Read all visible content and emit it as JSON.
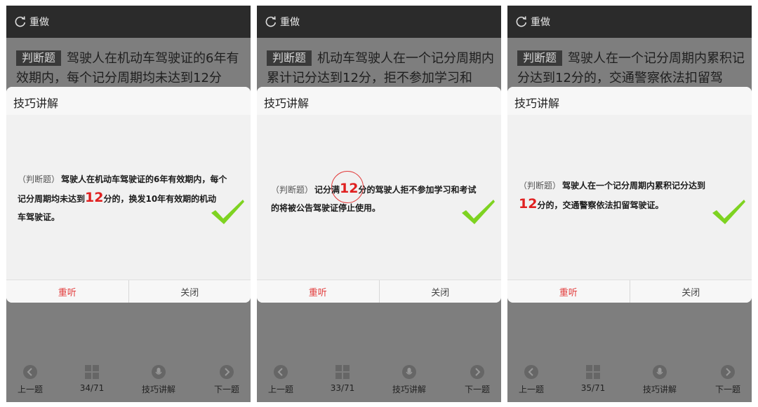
{
  "screens": [
    {
      "redo_label": "重做",
      "question_tag": "判断题",
      "question_text": "驾驶人在机动车驾驶证的6年有效期内，每个记分周期均未达到12分",
      "dialog_title": "技巧讲解",
      "explanation": {
        "prefix": "（判断题）",
        "line1": "驾驶人在机动车驾驶证的6年有效期内，每个",
        "line2_before": "记分周期均未达到",
        "highlight": "12",
        "line2_after": "分的，换发10年有效期的机动",
        "line3": "车驾驶证。"
      },
      "replay_label": "重听",
      "close_label": "关闭",
      "nav": {
        "prev": "上一题",
        "progress": "34/71",
        "tips": "技巧讲解",
        "next": "下一题"
      }
    },
    {
      "redo_label": "重做",
      "question_tag": "判断题",
      "question_text": "机动车驾驶人在一个记分周期内累计记分达到12分，拒不参加学习和",
      "dialog_title": "技巧讲解",
      "explanation": {
        "prefix": "（判断题）",
        "line1_before": "记分满",
        "highlight": "12",
        "line1_after": "分的驾驶人拒不参加学习和考试",
        "line2": "的将被公告驾驶证停止使用。"
      },
      "replay_label": "重听",
      "close_label": "关闭",
      "nav": {
        "prev": "上一题",
        "progress": "33/71",
        "tips": "技巧讲解",
        "next": "下一题"
      }
    },
    {
      "redo_label": "重做",
      "question_tag": "判断题",
      "question_text": "驾驶人在一个记分周期内累积记分达到12分的，交通警察依法扣留驾",
      "dialog_title": "技巧讲解",
      "explanation": {
        "prefix": "（判断题）",
        "line1": "驾驶人在一个记分周期内累积记分达到",
        "highlight": "12",
        "line2_after": "分的，交通警察依法扣留驾驶证。"
      },
      "replay_label": "重听",
      "close_label": "关闭",
      "nav": {
        "prev": "上一题",
        "progress": "35/71",
        "tips": "技巧讲解",
        "next": "下一题"
      }
    }
  ],
  "icons": {
    "redo": "refresh-icon",
    "prev": "chevron-left-circle-icon",
    "progress": "grid-icon",
    "tips": "microphone-icon",
    "next": "chevron-right-circle-icon",
    "correct": "checkmark-icon"
  },
  "colors": {
    "highlight": "#e02020",
    "checkmark": "#7ed321",
    "background": "#7e7e7e",
    "topbar": "#2b2b2b"
  }
}
